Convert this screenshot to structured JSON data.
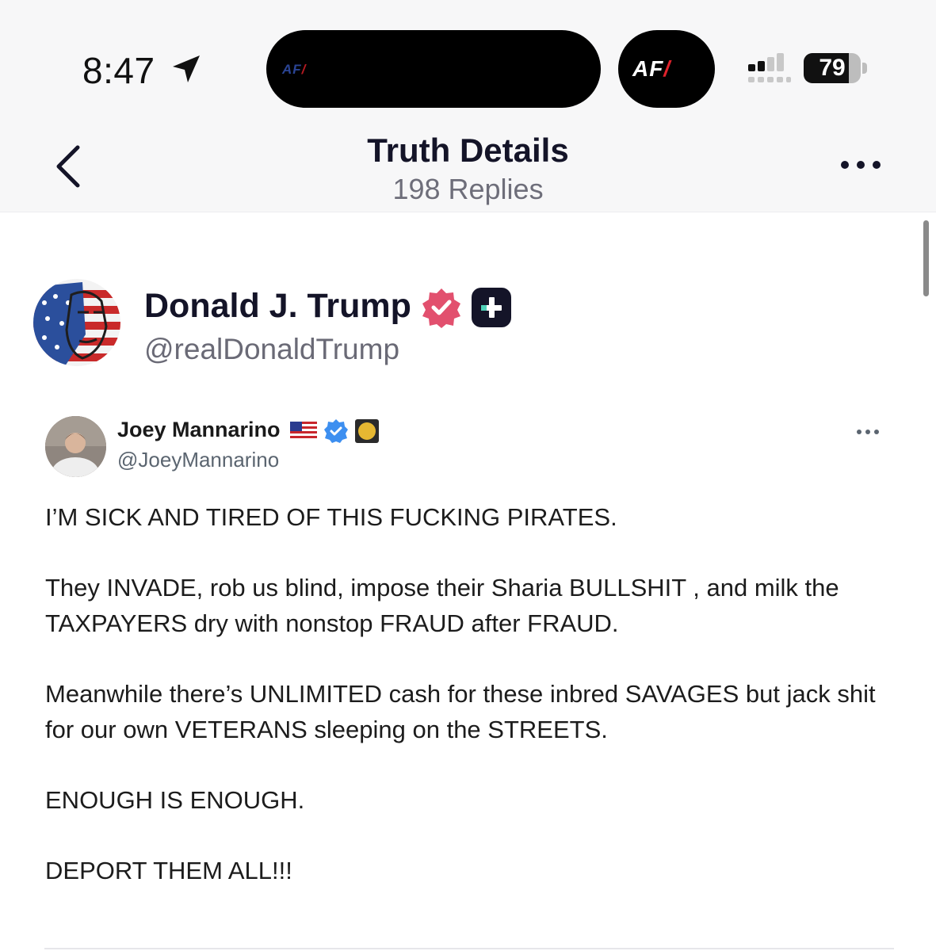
{
  "status_bar": {
    "time": "8:47",
    "island_logo": "AF",
    "live_activity_logo": "AF",
    "battery_percent": 79,
    "battery_text": "79"
  },
  "header": {
    "title": "Truth Details",
    "subtitle": "198 Replies"
  },
  "post": {
    "author_name": "Donald J. Trump",
    "author_handle": "@realDonaldTrump",
    "verified_color": "#e2506e"
  },
  "quoted_post": {
    "author_name": "Joey Mannarino",
    "author_handle": "@JoeyMannarino",
    "verified_color": "#3d8ff0",
    "paragraphs": [
      "I’M SICK AND TIRED OF THIS FUCKING PIRATES.",
      "They INVADE, rob us blind, impose their Sharia BULLSHIT , and milk the TAXPAYERS dry with nonstop FRAUD after FRAUD.",
      "Meanwhile there’s UNLIMITED cash for these inbred SAVAGES but jack shit for our own VETERANS sleeping on the STREETS.",
      "ENOUGH IS ENOUGH.",
      "DEPORT THEM ALL!!!"
    ]
  },
  "icons": {
    "location": "location-arrow-icon",
    "back": "chevron-left-icon",
    "more": "ellipsis-icon",
    "verified": "verified-badge-icon",
    "plus": "truth-plus-icon",
    "flag": "us-flag-icon",
    "coin": "gold-coin-icon",
    "signal": "cellular-signal-icon",
    "battery": "battery-icon"
  }
}
